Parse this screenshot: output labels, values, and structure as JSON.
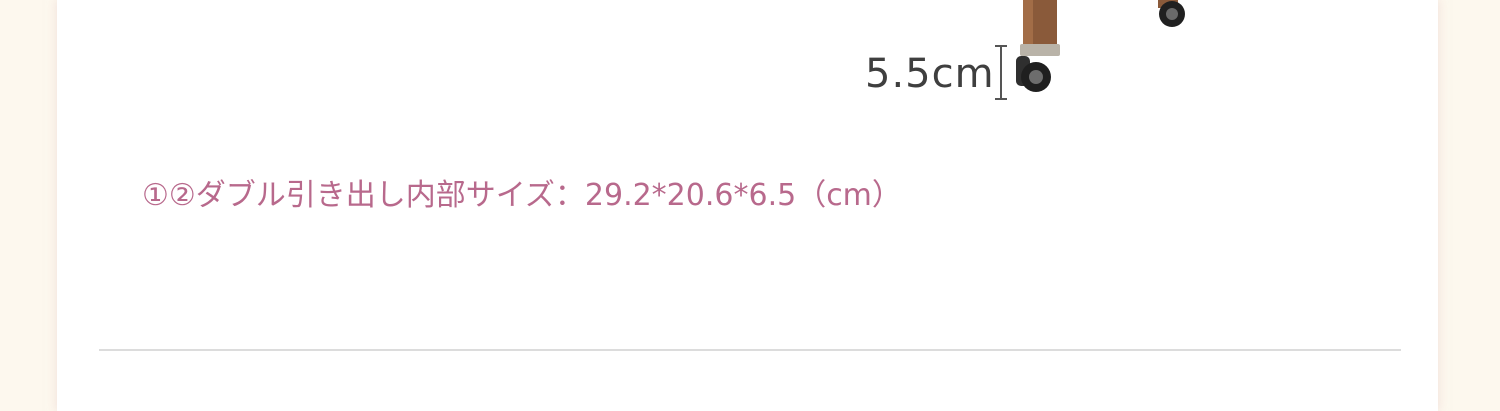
{
  "product_image": {
    "dimension_label": "5.5cm"
  },
  "spec": {
    "text": "①②ダブル引き出し内部サイズ：29.2*20.6*6.5（cm）"
  },
  "colors": {
    "spec_text": "#b8698c",
    "background": "#fdf8ee",
    "card": "#ffffff",
    "divider": "#dcdcdc"
  }
}
